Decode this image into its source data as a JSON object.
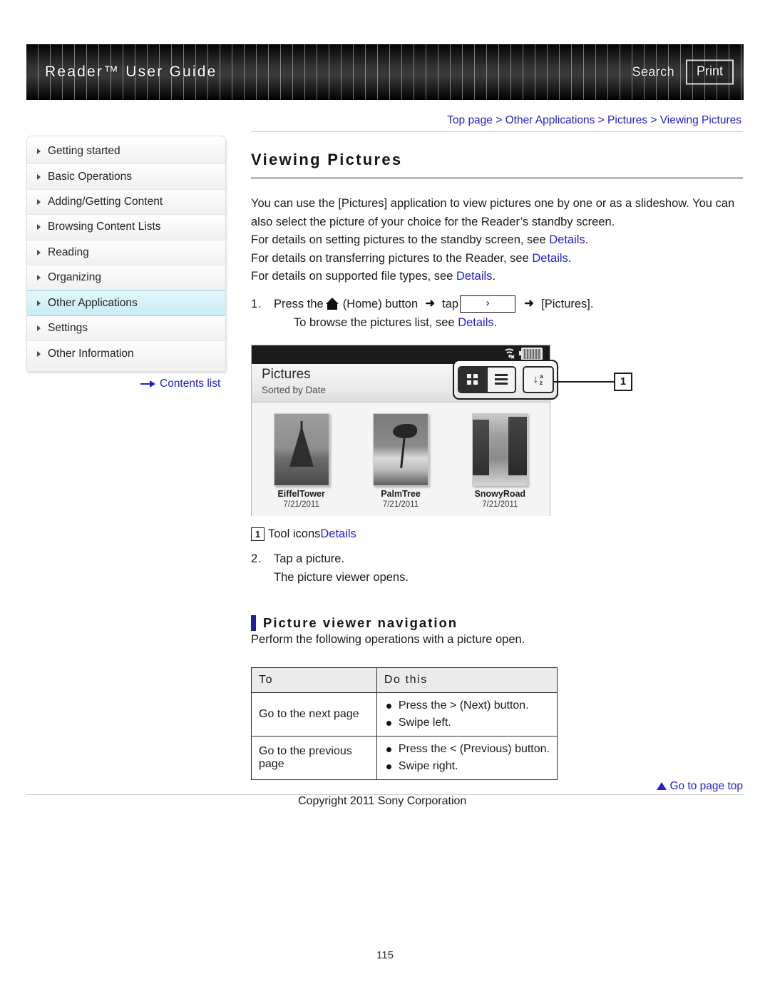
{
  "header": {
    "title": "Reader™ User Guide",
    "search_label": "Search",
    "print_label": "Print"
  },
  "sidebar": {
    "items": [
      {
        "label": "Getting started"
      },
      {
        "label": "Basic Operations"
      },
      {
        "label": "Adding/Getting Content"
      },
      {
        "label": "Browsing Content Lists"
      },
      {
        "label": "Reading"
      },
      {
        "label": "Organizing"
      },
      {
        "label": "Other Applications"
      },
      {
        "label": "Settings"
      },
      {
        "label": "Other Information"
      }
    ],
    "active_index": 6,
    "contents_link": "Contents list"
  },
  "main": {
    "breadcrumb": "Top page > Other Applications > Pictures > Viewing Pictures",
    "page_title": "Viewing Pictures",
    "intro_line1": "You can use the [Pictures] application to view pictures one by one or as a slideshow. You can",
    "intro_line2": "also select the picture of your choice for the Reader’s standby screen.",
    "detail_lines": [
      {
        "text": "For details on setting pictures to the standby screen, see ",
        "link": "Details",
        "tail": "."
      },
      {
        "text": "For details on transferring pictures to the Reader, see ",
        "link": "Details",
        "tail": "."
      },
      {
        "text": "For details on supported file types, see ",
        "link": "Details",
        "tail": "."
      }
    ],
    "step1": {
      "number": "1.",
      "pre": "Press the",
      "home_label": "(Home) button",
      "tap_label": "tap",
      "chevron": "›",
      "target": "[Pictures].",
      "sub_pre": "To browse the pictures list, see ",
      "sub_link": "Details",
      "sub_tail": "."
    },
    "callout_caption": {
      "marker": "1",
      "text": "Tool icons ",
      "link": "Details"
    },
    "callout_marker": "1",
    "step2": {
      "number": "2.",
      "line1": "Tap a picture.",
      "line2": "The picture viewer opens."
    },
    "subsection": {
      "heading": "Picture viewer navigation",
      "intro": "Perform the following operations with a picture open."
    }
  },
  "device": {
    "title": "Pictures",
    "subtitle": "Sorted by Date",
    "status_icons": [
      "wifi-off-icon",
      "battery-icon"
    ],
    "tool_icons": [
      "grid-view-icon",
      "list-view-icon",
      "sort-az-icon"
    ],
    "thumbnails": [
      {
        "name": "EiffelTower",
        "date": "7/21/2011",
        "art": "eiffel"
      },
      {
        "name": "PalmTree",
        "date": "7/21/2011",
        "art": "palm"
      },
      {
        "name": "SnowyRoad",
        "date": "7/21/2011",
        "art": "snowy"
      }
    ]
  },
  "table": {
    "headers": [
      "To",
      "Do this"
    ],
    "rows": [
      {
        "to": "Go to the next page",
        "do": [
          "Press the > (Next) button.",
          "Swipe left."
        ]
      },
      {
        "to": "Go to the previous page",
        "do": [
          "Press the < (Previous) button.",
          "Swipe right."
        ]
      }
    ]
  },
  "footer": {
    "go_to_top": "Go to page top",
    "copyright": "Copyright 2011 Sony Corporation",
    "page_number": "115"
  },
  "colors": {
    "link": "#2222CC",
    "accent_bar": "#1F1FA0",
    "active_nav": "#D4F1F8"
  }
}
